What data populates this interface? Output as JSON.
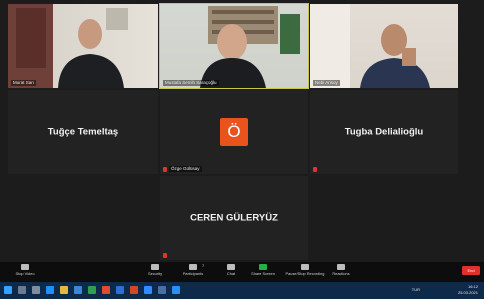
{
  "tiles": {
    "murat": {
      "name": "Murat Sarı"
    },
    "mustafa": {
      "name": "Mustafa Semih Saraçoğlu"
    },
    "nebi": {
      "name": "Nebi Arisoy"
    },
    "tugce": {
      "display": "Tuğçe Temeltaş"
    },
    "ozge": {
      "name": "Özge Gülüsay",
      "avatar_letter": "Ö"
    },
    "tugba": {
      "display": "Tugba Delialioğlu"
    },
    "ceren": {
      "display": "CEREN GÜLERYÜZ"
    }
  },
  "toolbar": {
    "stop_video": "Stop Video",
    "security": "Security",
    "participants": "Participants",
    "participants_count": "7",
    "chat": "Chat",
    "share_screen": "Share Screen",
    "record": "Pause/Stop Recording",
    "reactions": "Reactions",
    "end": "End"
  },
  "taskbar": {
    "lang": "TUR",
    "lang_sub": "TRQ",
    "time": "16:12",
    "date": "25.03.2021"
  },
  "colors": {
    "active_border": "#c9c545",
    "avatar_bg": "#e8541c",
    "end_bg": "#e02f2f"
  }
}
